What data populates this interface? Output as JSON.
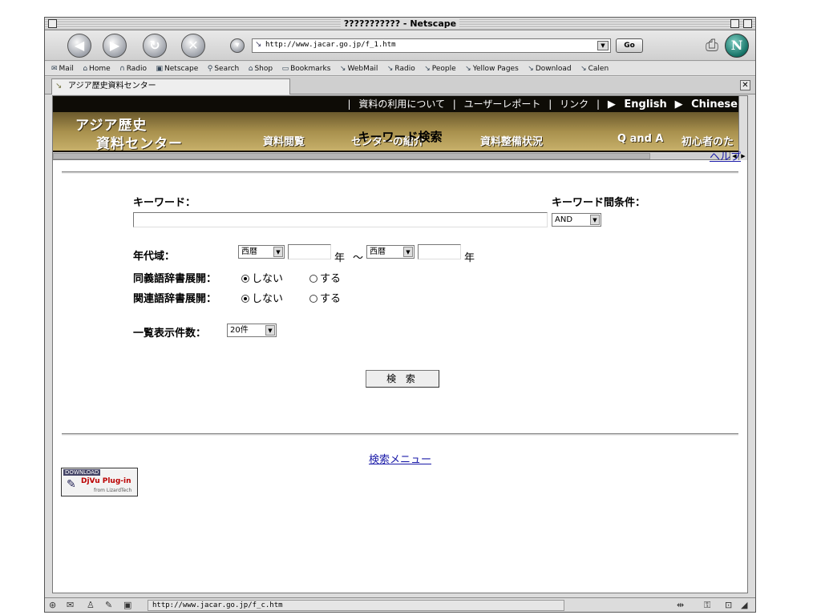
{
  "window": {
    "title": "??????????? - Netscape"
  },
  "toolbar": {
    "url": "http://www.jacar.go.jp/f_1.htm",
    "go_label": "Go"
  },
  "personal_toolbar": {
    "items": [
      "Mail",
      "Home",
      "Radio",
      "Netscape",
      "Search",
      "Shop",
      "Bookmarks",
      "WebMail",
      "Radio",
      "People",
      "Yellow Pages",
      "Download",
      "Calen"
    ]
  },
  "tab": {
    "label": "アジア歴史資料センター"
  },
  "banner": {
    "logo_line1": "アジア歴史",
    "logo_line2": "資料センター",
    "top_links": [
      "資料の利用について",
      "ユーザーレポート",
      "リンク",
      "English",
      "Chinese"
    ],
    "menu": [
      "資料閲覧",
      "センターの紹介",
      "資料整備状況",
      "Q and A",
      "初心者のた"
    ]
  },
  "page": {
    "title": "キーワード検索",
    "help_link": "ヘルプ",
    "keyword_label": "キーワード：",
    "keyword_value": "",
    "condition_label": "キーワード間条件：",
    "condition_value": "AND",
    "era_label": "年代域：",
    "era_from_calendar": "西暦",
    "era_from_year": "",
    "era_unit": "年",
    "era_sep": "～",
    "era_to_calendar": "西暦",
    "era_to_year": "",
    "synonym_label": "同義語辞書展開：",
    "related_label": "関連語辞書展開：",
    "opt_no": "しない",
    "opt_yes": "する",
    "count_label": "一覧表示件数：",
    "count_value": "20件",
    "search_button": "検 索",
    "search_menu_link": "検索メニュー",
    "djvu_download": "DOWNLOAD",
    "djvu_title": "DjVu Plug-in",
    "djvu_from": "from LizardTech"
  },
  "status": {
    "url": "http://www.jacar.go.jp/f_c.htm"
  }
}
